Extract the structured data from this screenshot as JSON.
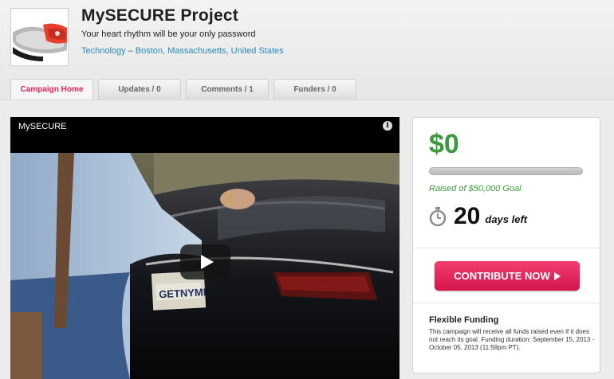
{
  "project": {
    "title": "MySECURE Project",
    "tagline": "Your heart rhythm will be your only password",
    "category": "Technology",
    "separator": "–",
    "location": "Boston, Massachusetts, United States"
  },
  "tabs": [
    {
      "label": "Campaign Home",
      "active": true
    },
    {
      "label": "Updates / 0",
      "active": false
    },
    {
      "label": "Comments / 1",
      "active": false
    },
    {
      "label": "Funders / 0",
      "active": false
    }
  ],
  "video": {
    "title": "MySECURE",
    "license_plate": "GETNYMI"
  },
  "funding": {
    "amount_raised": "$0",
    "progress_fraction": 0,
    "goal_text": "Raised of $50,000 Goal",
    "days_left": "20",
    "days_label": "days left",
    "contribute_label": "CONTRIBUTE NOW",
    "flexible_title": "Flexible Funding",
    "flexible_text": "This campaign will receive all funds raised even if it does not reach its goal. Funding duration: September 15, 2013 - October 05, 2013 (11:59pm PT)."
  },
  "colors": {
    "accent": "#e0265a",
    "money": "#3a9b3c",
    "link": "#2a8ab8"
  }
}
